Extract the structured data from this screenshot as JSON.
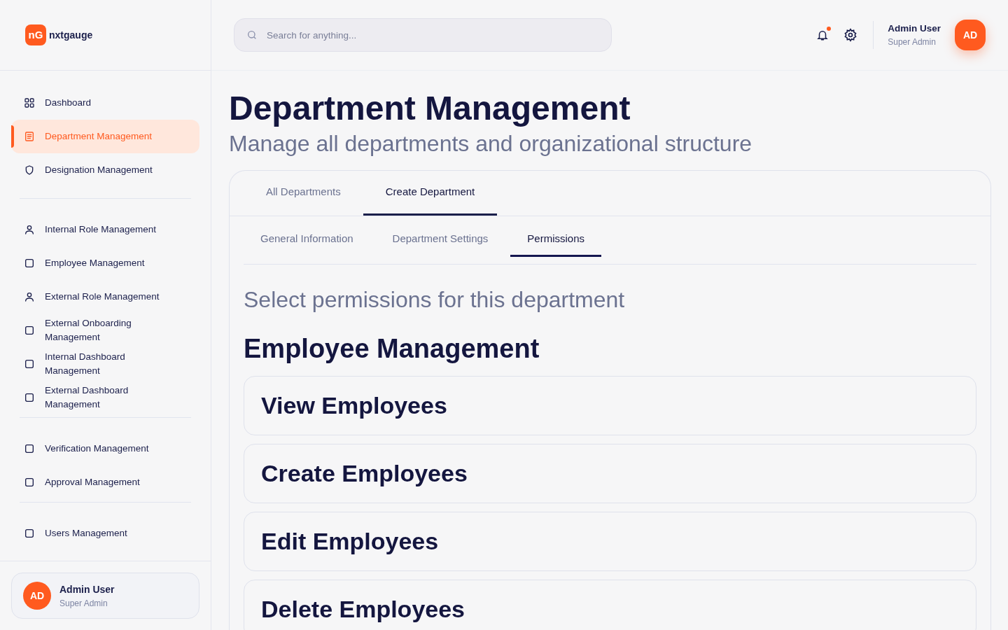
{
  "brand": {
    "mark": "nG",
    "name": "nxtgauge"
  },
  "sidebar": {
    "groups": [
      {
        "items": [
          {
            "label": "Dashboard",
            "kind": "grid",
            "selected": false
          },
          {
            "label": "Department Management",
            "kind": "document",
            "selected": true
          },
          {
            "label": "Designation Management",
            "kind": "shield",
            "selected": false
          }
        ]
      },
      {
        "items": [
          {
            "label": "Internal Role Management",
            "kind": "user",
            "selected": false
          },
          {
            "label": "Employee Management",
            "kind": "square",
            "selected": false
          },
          {
            "label": "External Role Management",
            "kind": "user",
            "selected": false
          },
          {
            "label": "External Onboarding Management",
            "kind": "square",
            "selected": false
          },
          {
            "label": "Internal Dashboard Management",
            "kind": "square",
            "selected": false
          },
          {
            "label": "External Dashboard Management",
            "kind": "square",
            "selected": false
          }
        ]
      },
      {
        "items": [
          {
            "label": "Verification Management",
            "kind": "square",
            "selected": false
          },
          {
            "label": "Approval Management",
            "kind": "square",
            "selected": false
          }
        ]
      },
      {
        "items": [
          {
            "label": "Users Management",
            "kind": "square",
            "selected": false
          }
        ]
      }
    ],
    "user": {
      "initials": "AD",
      "name": "Admin User",
      "role": "Super Admin"
    }
  },
  "header": {
    "search": {
      "placeholder": "Search for anything..."
    },
    "notification_unread": true,
    "user": {
      "initials": "AD",
      "name": "Admin User",
      "role": "Super Admin"
    }
  },
  "page": {
    "title": "Department Management",
    "subtitle": "Manage all departments and organizational structure"
  },
  "tabs": [
    {
      "label": "All Departments",
      "selected": false
    },
    {
      "label": "Create Department",
      "selected": true
    }
  ],
  "subtabs": [
    {
      "label": "General Information",
      "selected": false
    },
    {
      "label": "Department Settings",
      "selected": false
    },
    {
      "label": "Permissions",
      "selected": true
    }
  ],
  "permissions": {
    "prompt": "Select permissions for this department",
    "section": "Employee Management",
    "items": [
      "View Employees",
      "Create Employees",
      "Edit Employees",
      "Delete Employees"
    ]
  }
}
